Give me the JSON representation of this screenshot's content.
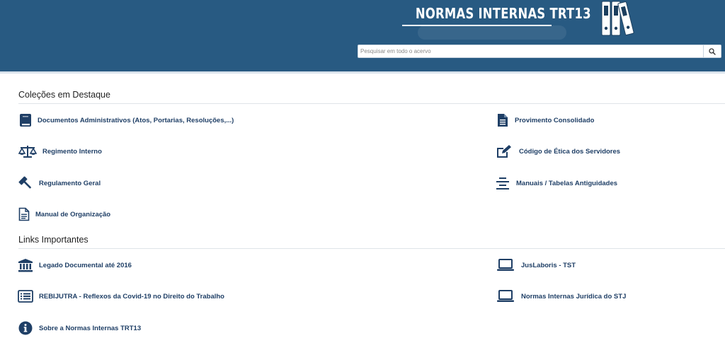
{
  "header": {
    "site_title": "NORMAS INTERNAS TRT13",
    "search_placeholder": "Pesquisar em todo o acervo",
    "icon": "binders-icon",
    "colors": {
      "header_bg": "#285a82",
      "link": "#1f3f66"
    }
  },
  "featured": {
    "title": "Coleções em Destaque",
    "items": [
      {
        "label": "Documentos Administrativos (Atos, Portarias, Resoluções,...)",
        "icon": "book-icon"
      },
      {
        "label": "Provimento Consolidado",
        "icon": "document-icon"
      },
      {
        "label": "Regimento Interno",
        "icon": "scales-icon"
      },
      {
        "label": "Código de Ética dos Servidores",
        "icon": "edit-icon"
      },
      {
        "label": "Regulamento Geral",
        "icon": "gavel-icon"
      },
      {
        "label": "Manuais / Tabelas Antiguidades",
        "icon": "align-center-icon"
      },
      {
        "label": "Manual de Organização",
        "icon": "document-outline-icon"
      }
    ]
  },
  "links": {
    "title": "Links Importantes",
    "items": [
      {
        "label": "Legado Documental até 2016",
        "icon": "bank-icon"
      },
      {
        "label": "JusLaboris - TST",
        "icon": "laptop-icon"
      },
      {
        "label": "REBIJUTRA - Reflexos da Covid-19 no Direito do Trabalho",
        "icon": "list-icon"
      },
      {
        "label": "Normas Internas Jurídica do STJ",
        "icon": "laptop-icon"
      },
      {
        "label": "Sobre a Normas Internas TRT13",
        "icon": "info-icon"
      }
    ]
  }
}
